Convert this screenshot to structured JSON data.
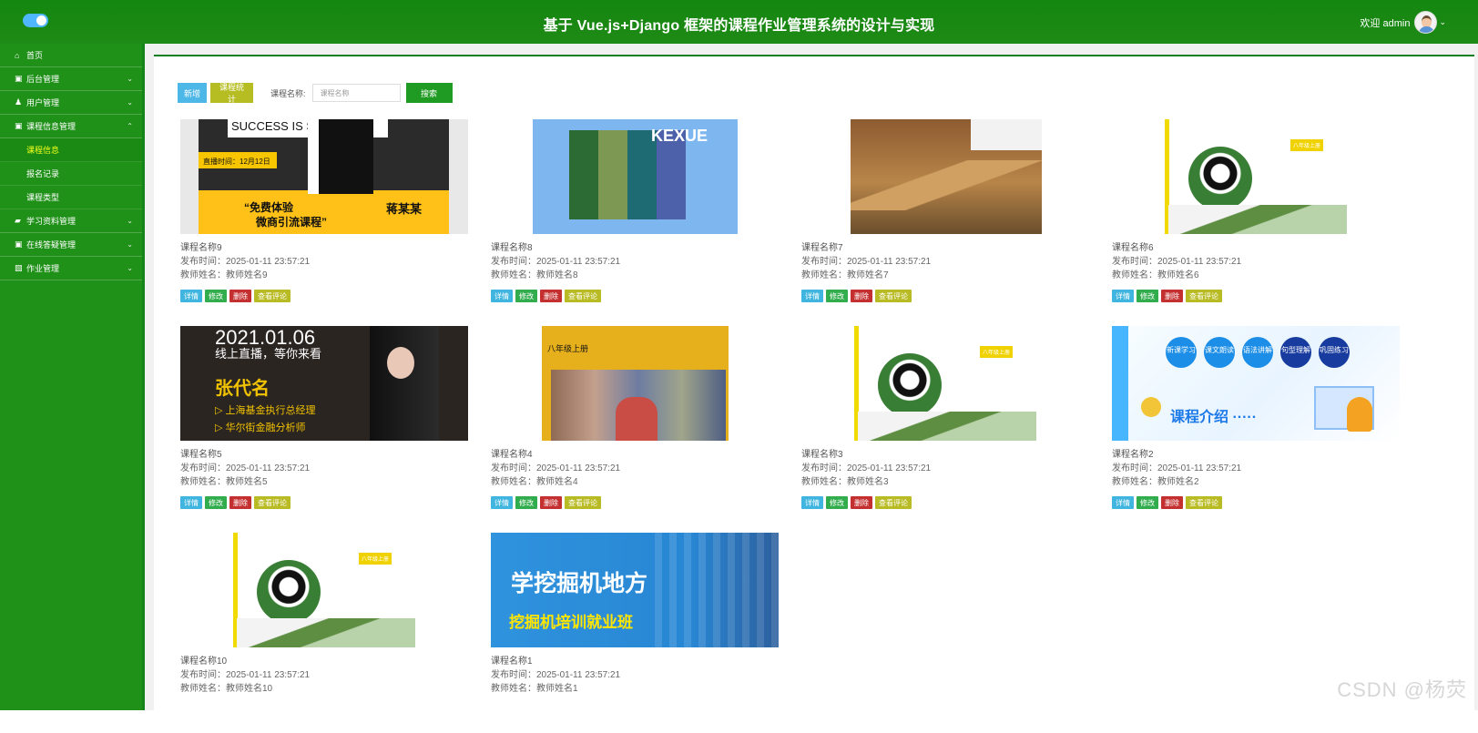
{
  "header": {
    "title": "基于 Vue.js+Django 框架的课程作业管理系统的设计与实现",
    "welcome": "欢迎 admin"
  },
  "sidebar": {
    "items": [
      {
        "icon": "⌂",
        "label": "首页"
      },
      {
        "icon": "▣",
        "label": "后台管理"
      },
      {
        "icon": "♟",
        "label": "用户管理"
      },
      {
        "icon": "▣",
        "label": "课程信息管理"
      },
      {
        "icon": "",
        "label": "课程信息"
      },
      {
        "icon": "",
        "label": "报名记录"
      },
      {
        "icon": "",
        "label": "课程类型"
      },
      {
        "icon": "▰",
        "label": "学习资料管理"
      },
      {
        "icon": "▣",
        "label": "在线答疑管理"
      },
      {
        "icon": "▧",
        "label": "作业管理"
      }
    ]
  },
  "toolbar": {
    "new_label": "新增",
    "stats_label": "课程统计",
    "search_label": "课程名称:",
    "search_placeholder": "课程名称",
    "search_button": "搜索"
  },
  "cards": [
    {
      "name": "课程名称9",
      "time": "发布时间：2025-01-11 23:57:21",
      "teacher": "教师姓名：教师姓名9"
    },
    {
      "name": "课程名称8",
      "time": "发布时间：2025-01-11 23:57:21",
      "teacher": "教师姓名：教师姓名8"
    },
    {
      "name": "课程名称7",
      "time": "发布时间：2025-01-11 23:57:21",
      "teacher": "教师姓名：教师姓名7"
    },
    {
      "name": "课程名称6",
      "time": "发布时间：2025-01-11 23:57:21",
      "teacher": "教师姓名：教师姓名6"
    },
    {
      "name": "课程名称5",
      "time": "发布时间：2025-01-11 23:57:21",
      "teacher": "教师姓名：教师姓名5"
    },
    {
      "name": "课程名称4",
      "time": "发布时间：2025-01-11 23:57:21",
      "teacher": "教师姓名：教师姓名4"
    },
    {
      "name": "课程名称3",
      "time": "发布时间：2025-01-11 23:57:21",
      "teacher": "教师姓名：教师姓名3"
    },
    {
      "name": "课程名称2",
      "time": "发布时间：2025-01-11 23:57:21",
      "teacher": "教师姓名：教师姓名2"
    },
    {
      "name": "课程名称10",
      "time": "发布时间：2025-01-11 23:57:21",
      "teacher": "教师姓名：教师姓名10"
    },
    {
      "name": "课程名称1",
      "time": "发布时间：2025-01-11 23:57:21",
      "teacher": "教师姓名：教师姓名1"
    }
  ],
  "actions": {
    "detail": "详情",
    "edit": "修改",
    "delete": "删除",
    "review": "查看评论"
  },
  "images": {
    "c9": {
      "headline": "SUCCESS IS SIMPLE",
      "line1": "直播时间：12月12日",
      "line2": "“免费体验",
      "line3": "微商引流课程”",
      "speaker": "蒋某某"
    },
    "c8": {
      "text": "KEXUE"
    },
    "c5": {
      "date": "2021.01.06",
      "tagline": "线上直播，等你来看",
      "name": "张代名",
      "item1": "▷ 上海基金执行总经理",
      "item2": "▷ 华尔街金融分析师"
    },
    "c4": {
      "grade": "八年级上册"
    },
    "c2": {
      "bubble1": "新课学习",
      "bubble2": "课文朗读",
      "bubble3": "语法讲解",
      "bubble4": "句型理解",
      "bubble5": "巩固练习",
      "banner": "课程介绍 ·····"
    },
    "c1": {
      "title": "学挖掘机地方",
      "subtitle": "挖掘机培训就业班"
    }
  },
  "watermark": "CSDN @杨荧"
}
